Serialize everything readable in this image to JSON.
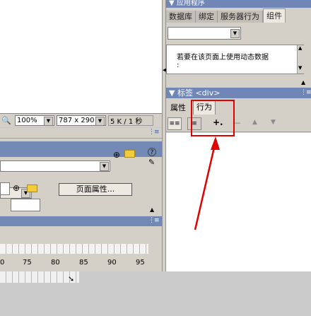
{
  "status_bar": {
    "zoom": "100%",
    "window_size": "787 x 290",
    "doc_stats": "5 K / 1 秒"
  },
  "properties": {
    "page_properties_button": "页面属性..."
  },
  "ruler": {
    "labels": [
      "0",
      "75",
      "80",
      "85",
      "90",
      "95"
    ]
  },
  "application_panel": {
    "title": "应用程序",
    "tabs": [
      "数据库",
      "绑定",
      "服务器行为",
      "组件"
    ],
    "active_tab": "组件",
    "message": "若要在该页面上使用动态数据",
    "message_line2": ":"
  },
  "tag_panel": {
    "title": "▼ 标签 <div>",
    "tabs": [
      "属性",
      "行为"
    ],
    "active_tab": "行为",
    "add_behavior_glyph": "+.",
    "remove_glyph": "−",
    "up_glyph": "▲",
    "down_glyph": "▼"
  },
  "colors": {
    "highlight": "#e10000",
    "panel_title": "#6f86b6"
  }
}
